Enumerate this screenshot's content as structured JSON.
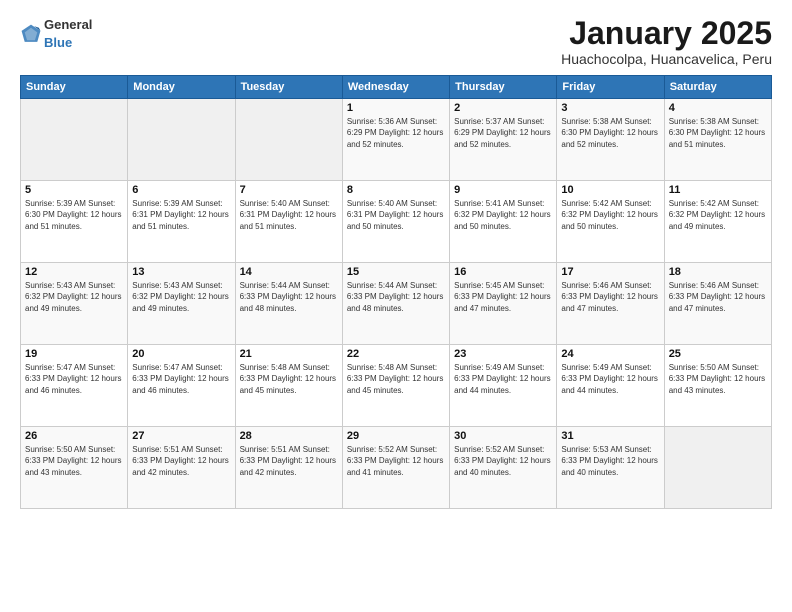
{
  "header": {
    "logo": {
      "general": "General",
      "blue": "Blue"
    },
    "title": "January 2025",
    "location": "Huachocolpa, Huancavelica, Peru"
  },
  "days_of_week": [
    "Sunday",
    "Monday",
    "Tuesday",
    "Wednesday",
    "Thursday",
    "Friday",
    "Saturday"
  ],
  "weeks": [
    {
      "days": [
        {
          "num": "",
          "info": ""
        },
        {
          "num": "",
          "info": ""
        },
        {
          "num": "",
          "info": ""
        },
        {
          "num": "1",
          "info": "Sunrise: 5:36 AM\nSunset: 6:29 PM\nDaylight: 12 hours\nand 52 minutes."
        },
        {
          "num": "2",
          "info": "Sunrise: 5:37 AM\nSunset: 6:29 PM\nDaylight: 12 hours\nand 52 minutes."
        },
        {
          "num": "3",
          "info": "Sunrise: 5:38 AM\nSunset: 6:30 PM\nDaylight: 12 hours\nand 52 minutes."
        },
        {
          "num": "4",
          "info": "Sunrise: 5:38 AM\nSunset: 6:30 PM\nDaylight: 12 hours\nand 51 minutes."
        }
      ]
    },
    {
      "days": [
        {
          "num": "5",
          "info": "Sunrise: 5:39 AM\nSunset: 6:30 PM\nDaylight: 12 hours\nand 51 minutes."
        },
        {
          "num": "6",
          "info": "Sunrise: 5:39 AM\nSunset: 6:31 PM\nDaylight: 12 hours\nand 51 minutes."
        },
        {
          "num": "7",
          "info": "Sunrise: 5:40 AM\nSunset: 6:31 PM\nDaylight: 12 hours\nand 51 minutes."
        },
        {
          "num": "8",
          "info": "Sunrise: 5:40 AM\nSunset: 6:31 PM\nDaylight: 12 hours\nand 50 minutes."
        },
        {
          "num": "9",
          "info": "Sunrise: 5:41 AM\nSunset: 6:32 PM\nDaylight: 12 hours\nand 50 minutes."
        },
        {
          "num": "10",
          "info": "Sunrise: 5:42 AM\nSunset: 6:32 PM\nDaylight: 12 hours\nand 50 minutes."
        },
        {
          "num": "11",
          "info": "Sunrise: 5:42 AM\nSunset: 6:32 PM\nDaylight: 12 hours\nand 49 minutes."
        }
      ]
    },
    {
      "days": [
        {
          "num": "12",
          "info": "Sunrise: 5:43 AM\nSunset: 6:32 PM\nDaylight: 12 hours\nand 49 minutes."
        },
        {
          "num": "13",
          "info": "Sunrise: 5:43 AM\nSunset: 6:32 PM\nDaylight: 12 hours\nand 49 minutes."
        },
        {
          "num": "14",
          "info": "Sunrise: 5:44 AM\nSunset: 6:33 PM\nDaylight: 12 hours\nand 48 minutes."
        },
        {
          "num": "15",
          "info": "Sunrise: 5:44 AM\nSunset: 6:33 PM\nDaylight: 12 hours\nand 48 minutes."
        },
        {
          "num": "16",
          "info": "Sunrise: 5:45 AM\nSunset: 6:33 PM\nDaylight: 12 hours\nand 47 minutes."
        },
        {
          "num": "17",
          "info": "Sunrise: 5:46 AM\nSunset: 6:33 PM\nDaylight: 12 hours\nand 47 minutes."
        },
        {
          "num": "18",
          "info": "Sunrise: 5:46 AM\nSunset: 6:33 PM\nDaylight: 12 hours\nand 47 minutes."
        }
      ]
    },
    {
      "days": [
        {
          "num": "19",
          "info": "Sunrise: 5:47 AM\nSunset: 6:33 PM\nDaylight: 12 hours\nand 46 minutes."
        },
        {
          "num": "20",
          "info": "Sunrise: 5:47 AM\nSunset: 6:33 PM\nDaylight: 12 hours\nand 46 minutes."
        },
        {
          "num": "21",
          "info": "Sunrise: 5:48 AM\nSunset: 6:33 PM\nDaylight: 12 hours\nand 45 minutes."
        },
        {
          "num": "22",
          "info": "Sunrise: 5:48 AM\nSunset: 6:33 PM\nDaylight: 12 hours\nand 45 minutes."
        },
        {
          "num": "23",
          "info": "Sunrise: 5:49 AM\nSunset: 6:33 PM\nDaylight: 12 hours\nand 44 minutes."
        },
        {
          "num": "24",
          "info": "Sunrise: 5:49 AM\nSunset: 6:33 PM\nDaylight: 12 hours\nand 44 minutes."
        },
        {
          "num": "25",
          "info": "Sunrise: 5:50 AM\nSunset: 6:33 PM\nDaylight: 12 hours\nand 43 minutes."
        }
      ]
    },
    {
      "days": [
        {
          "num": "26",
          "info": "Sunrise: 5:50 AM\nSunset: 6:33 PM\nDaylight: 12 hours\nand 43 minutes."
        },
        {
          "num": "27",
          "info": "Sunrise: 5:51 AM\nSunset: 6:33 PM\nDaylight: 12 hours\nand 42 minutes."
        },
        {
          "num": "28",
          "info": "Sunrise: 5:51 AM\nSunset: 6:33 PM\nDaylight: 12 hours\nand 42 minutes."
        },
        {
          "num": "29",
          "info": "Sunrise: 5:52 AM\nSunset: 6:33 PM\nDaylight: 12 hours\nand 41 minutes."
        },
        {
          "num": "30",
          "info": "Sunrise: 5:52 AM\nSunset: 6:33 PM\nDaylight: 12 hours\nand 40 minutes."
        },
        {
          "num": "31",
          "info": "Sunrise: 5:53 AM\nSunset: 6:33 PM\nDaylight: 12 hours\nand 40 minutes."
        },
        {
          "num": "",
          "info": ""
        }
      ]
    }
  ]
}
